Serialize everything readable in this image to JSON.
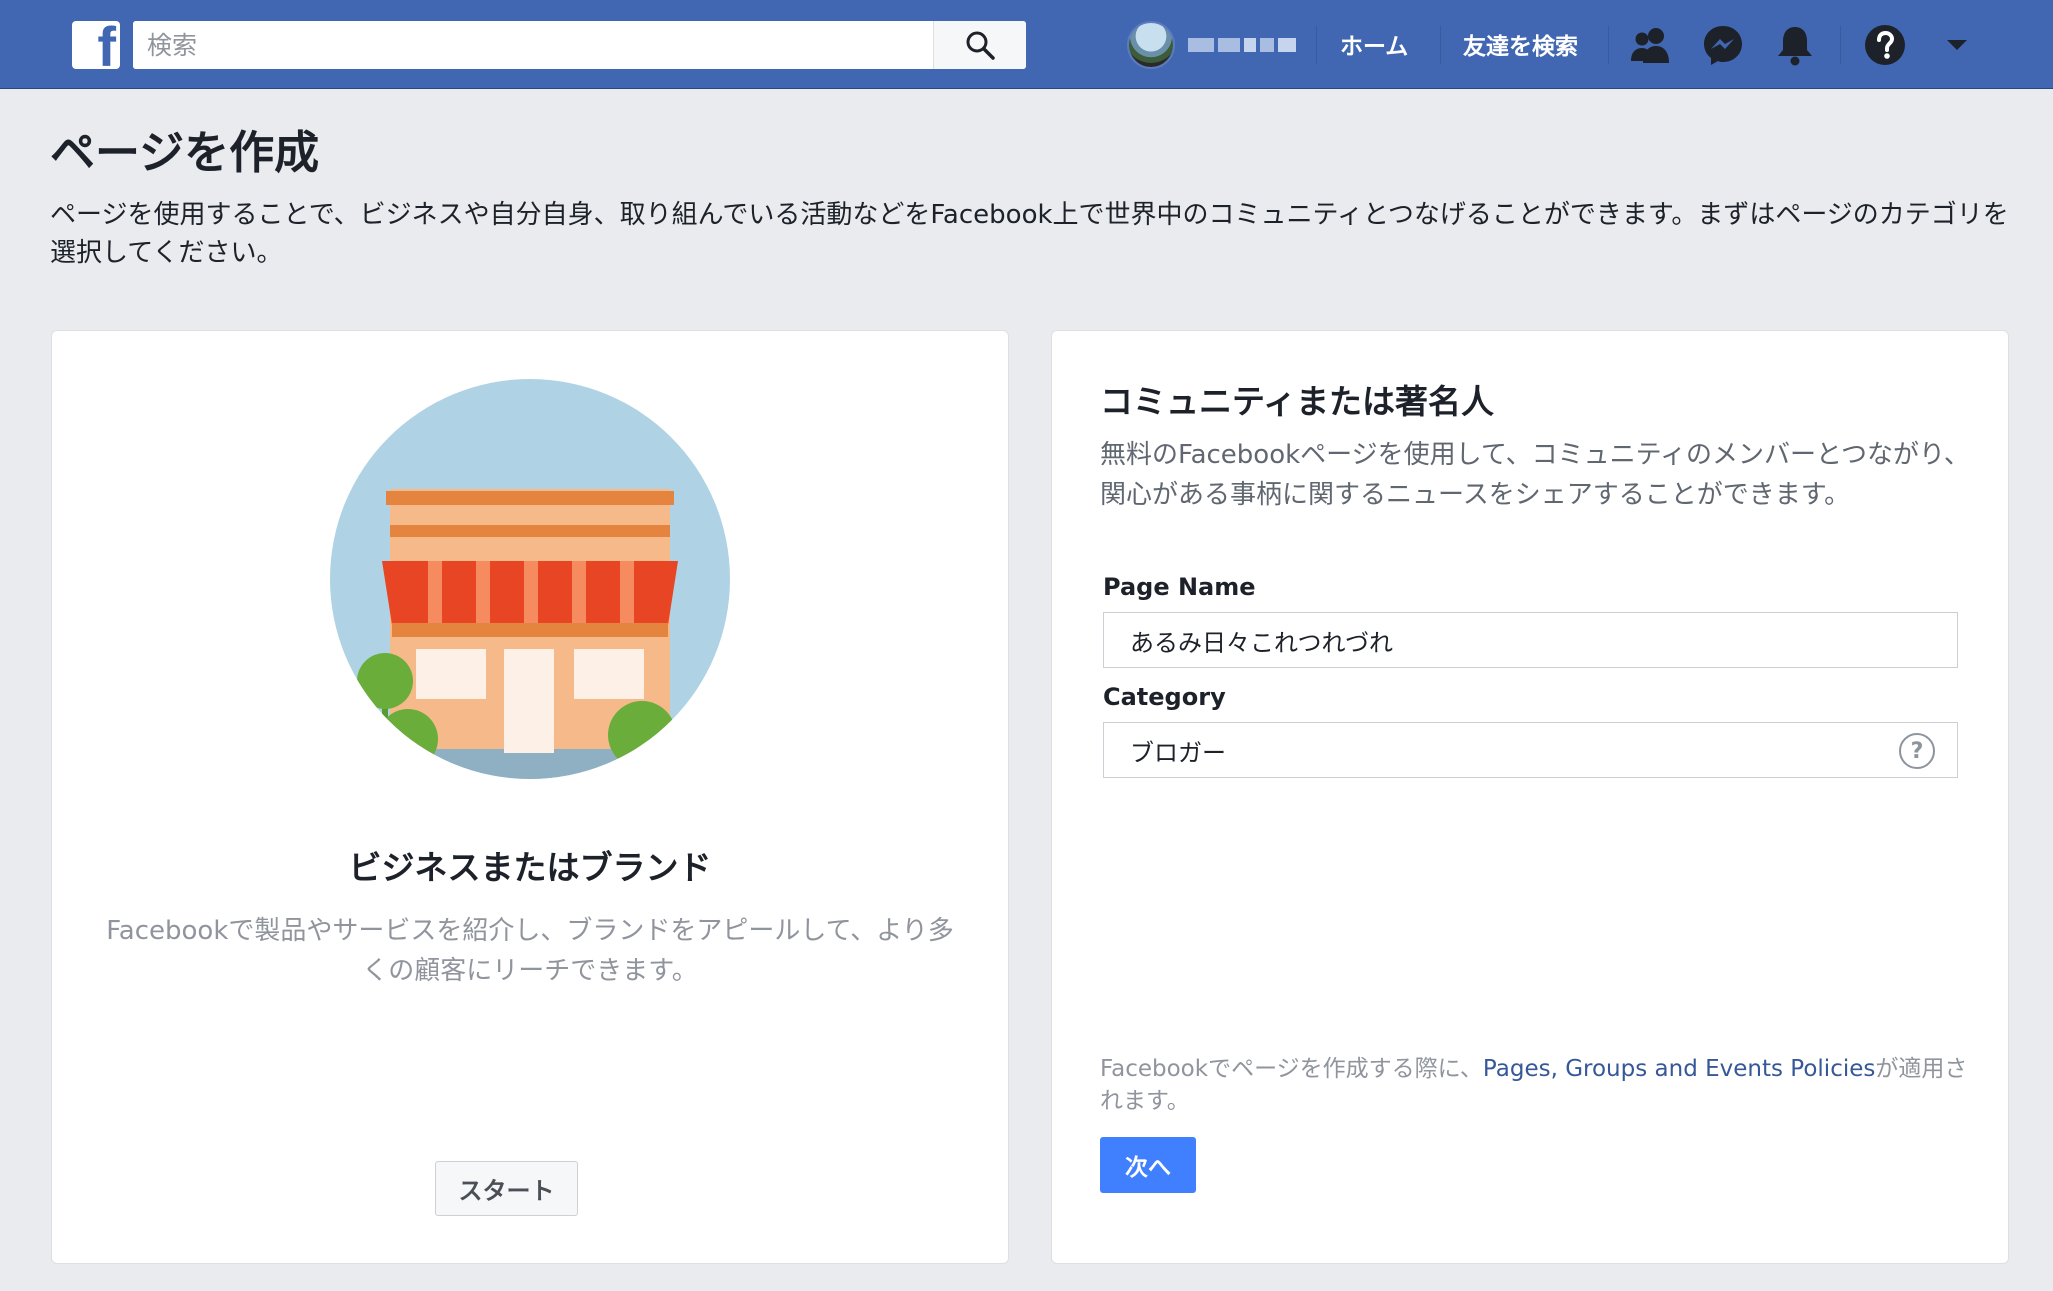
{
  "topbar": {
    "logo_letter": "f",
    "search_placeholder": "検索",
    "nav": {
      "home": "ホーム",
      "find_friends": "友達を検索"
    },
    "icons": [
      "friends-icon",
      "messenger-icon",
      "notifications-icon",
      "help-icon",
      "account-menu-icon"
    ]
  },
  "page": {
    "title": "ページを作成",
    "description": "ページを使用することで、ビジネスや自分自身、取り組んでいる活動などをFacebook上で世界中のコミュニティとつなげることができます。まずはページのカテゴリを選択してください。"
  },
  "business_card": {
    "title": "ビジネスまたはブランド",
    "description": "Facebookで製品やサービスを紹介し、ブランドをアピールして、より多くの顧客にリーチできます。",
    "start_label": "スタート"
  },
  "community_card": {
    "title": "コミュニティまたは著名人",
    "description": "無料のFacebookページを使用して、コミュニティのメンバーとつながり、関心がある事柄に関するニュースをシェアすることができます。",
    "page_name_label": "Page Name",
    "page_name_value": "あるみ日々これつれづれ",
    "category_label": "Category",
    "category_value": "ブロガー",
    "help_glyph": "?",
    "policy_prefix": "Facebookでページを作成する際に、",
    "policy_link": "Pages, Groups and Events Policies",
    "policy_suffix": "が適用されます。",
    "next_label": "次へ"
  },
  "colors": {
    "topbar": "#4267b2",
    "background": "#e9ebee",
    "primary_button": "#4080ff",
    "link": "#365899"
  }
}
